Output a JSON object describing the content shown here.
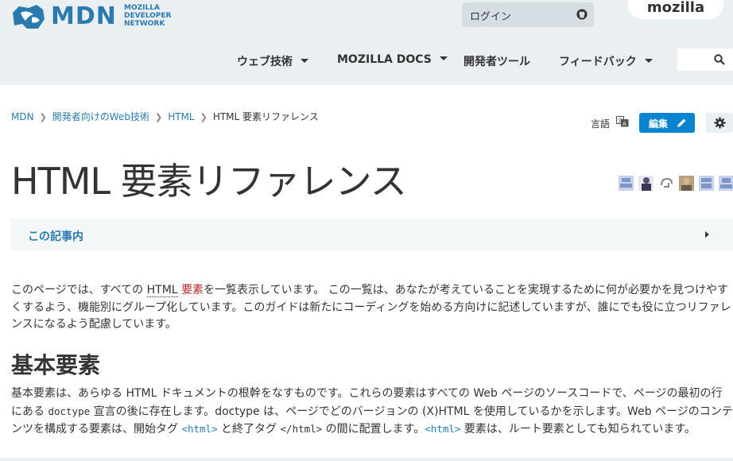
{
  "header": {
    "logo": {
      "name": "MDN",
      "sub": [
        "MOZILLA",
        "DEVELOPER",
        "NETWORK"
      ]
    },
    "login": {
      "label": "ログイン"
    },
    "mozilla": "mozilla",
    "nav": [
      {
        "label": "ウェブ技術",
        "has_dropdown": true
      },
      {
        "label": "MOZILLA DOCS",
        "has_dropdown": true
      },
      {
        "label": "開発者ツール",
        "has_dropdown": false
      },
      {
        "label": "フィードバック",
        "has_dropdown": true
      }
    ],
    "search": {
      "placeholder": ""
    }
  },
  "breadcrumb": {
    "items": [
      "MDN",
      "開発者向けのWeb技術",
      "HTML"
    ],
    "current": "HTML 要素リファレンス"
  },
  "toolbar": {
    "language_label": "言語",
    "edit_label": "編集"
  },
  "page": {
    "title": "HTML 要素リファレンス",
    "toc_label": "この記事内"
  },
  "intro": {
    "text1": "このページでは、すべての ",
    "abbr": "HTML",
    "text2": " ",
    "link": "要素",
    "text3": "を一覧表示しています。 この一覧は、あなたが考えていることを実現するために何が必要かを見つけやすくするよう、機能別にグループ化しています。このガイドは新たにコーディングを始める方向けに記述していますが、誰にでも役に立つリファレンスになるよう配慮しています。"
  },
  "section": {
    "heading": "基本要素",
    "p1": "基本要素は、あらゆる HTML ドキュメントの根幹をなすものです。これらの要素はすべての Web ページのソースコードで、ページの最初の行にある ",
    "code_doctype": "doctype",
    "p2": " 宣言の後に存在します。doctype は、ページでどのバージョンの (X)HTML を使用しているかを示します。Web ページのコンテンツを構成する要素は、開始タグ ",
    "code_html_open": "<html>",
    "p3": " と終了タグ ",
    "code_html_close": "</html>",
    "p4": " の間に配置します。",
    "code_html": "<html>",
    "p5": " 要素は、ルート要素としても知られています。"
  },
  "colors": {
    "header_bg": "#eaeff2",
    "link": "#2a7ab0",
    "edit_button": "#0a84ce",
    "element_link": "#b4272a"
  }
}
